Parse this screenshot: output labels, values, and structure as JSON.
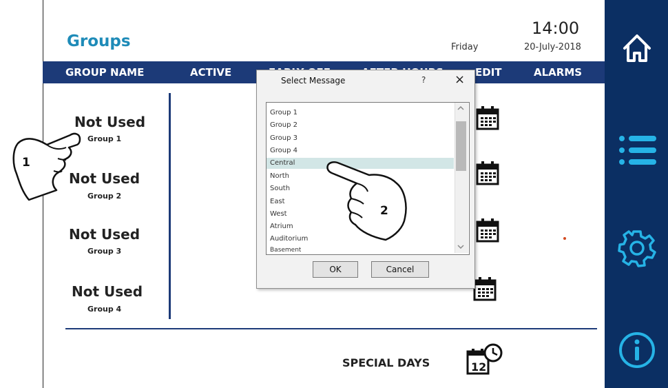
{
  "header": {
    "title": "Groups",
    "day": "Friday",
    "time": "14:00",
    "date": "20-July-2018"
  },
  "columns": [
    "GROUP NAME",
    "ACTIVE",
    "EARLY OFF",
    "AFTER HOURS",
    "EDIT",
    "ALARMS"
  ],
  "groups": [
    {
      "name": "Not Used",
      "label": "Group 1"
    },
    {
      "name": "Not Used",
      "label": "Group 2"
    },
    {
      "name": "Not Used",
      "label": "Group 3"
    },
    {
      "name": "Not Used",
      "label": "Group 4"
    }
  ],
  "footer": {
    "special_days": "SPECIAL DAYS",
    "special_days_icon_num": "12"
  },
  "dialog": {
    "title": "Select Message",
    "help": "?",
    "close": "×",
    "items": [
      "Group 1",
      "Group 2",
      "Group 3",
      "Group 4",
      "Central",
      "North",
      "South",
      "East",
      "West",
      "Atrium",
      "Auditorium",
      "Basement"
    ],
    "selected": "Central",
    "ok": "OK",
    "cancel": "Cancel"
  },
  "callouts": {
    "hand1": "1",
    "hand2": "2"
  },
  "nav": [
    "home-icon",
    "menu-icon",
    "settings-icon",
    "info-icon"
  ],
  "colors": {
    "title": "#1e8bb8",
    "bar": "#1c3a78",
    "rail": "#0b2f63",
    "selected_row": "#d2e6e6",
    "alarm_dot": "#d34a20"
  }
}
